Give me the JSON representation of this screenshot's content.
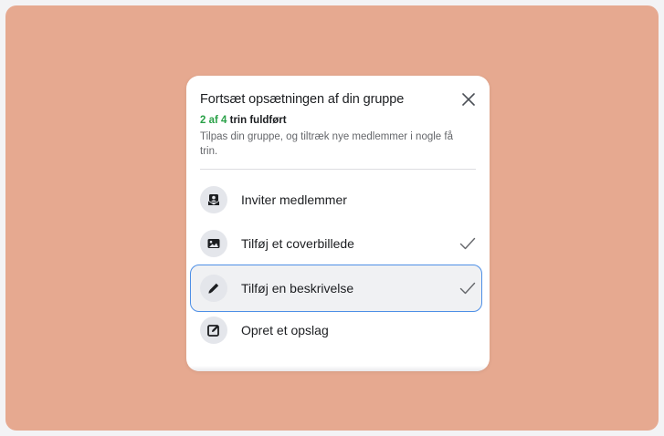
{
  "panel": {
    "title": "Fortsæt opsætningen af din gruppe",
    "progress_done": "2 af 4",
    "progress_rest": " trin fuldført",
    "subtitle": "Tilpas din gruppe, og tiltræk nye medlemmer i nogle få trin."
  },
  "steps": [
    {
      "label": "Inviter medlemmer",
      "icon": "invite-icon",
      "completed": false,
      "selected": false
    },
    {
      "label": "Tilføj et coverbillede",
      "icon": "image-icon",
      "completed": true,
      "selected": false
    },
    {
      "label": "Tilføj en beskrivelse",
      "icon": "pencil-icon",
      "completed": true,
      "selected": true
    },
    {
      "label": "Opret et opslag",
      "icon": "edit-post-icon",
      "completed": false,
      "selected": false
    }
  ],
  "colors": {
    "backdrop": "#e6a990",
    "accent_green": "#2aa148",
    "focus_blue": "#4d8fe6"
  }
}
